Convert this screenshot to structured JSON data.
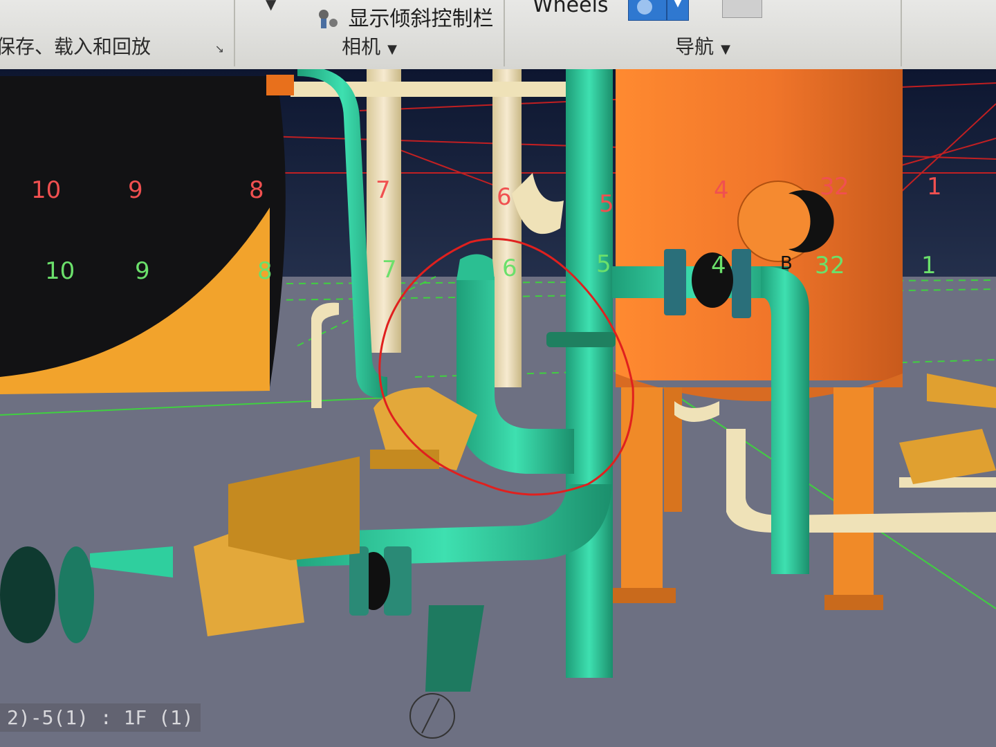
{
  "ribbon": {
    "save_group_label": "保存、载入和回放",
    "tilt_bar_label": "显示倾斜控制栏",
    "camera_group_label": "相机",
    "wheels_label": "Wheels",
    "nav_group_label": "导航"
  },
  "grid_labels": {
    "red": [
      "10",
      "9",
      "8",
      "7",
      "6",
      "5",
      "4",
      "3",
      "2",
      "1"
    ],
    "green": [
      "10",
      "9",
      "8",
      "7",
      "6",
      "5",
      "4",
      "3",
      "2",
      "1"
    ],
    "marker_b": "B"
  },
  "status_text": "2)-5(1) : 1F (1)",
  "colors": {
    "pipe_green": "#2fcf9e",
    "vessel_orange": "#f07a2a",
    "pump_yellow": "#e3a83a",
    "cream_pipe": "#efe2b8",
    "floor": "#6d7082",
    "markup_red": "#e0201e"
  }
}
